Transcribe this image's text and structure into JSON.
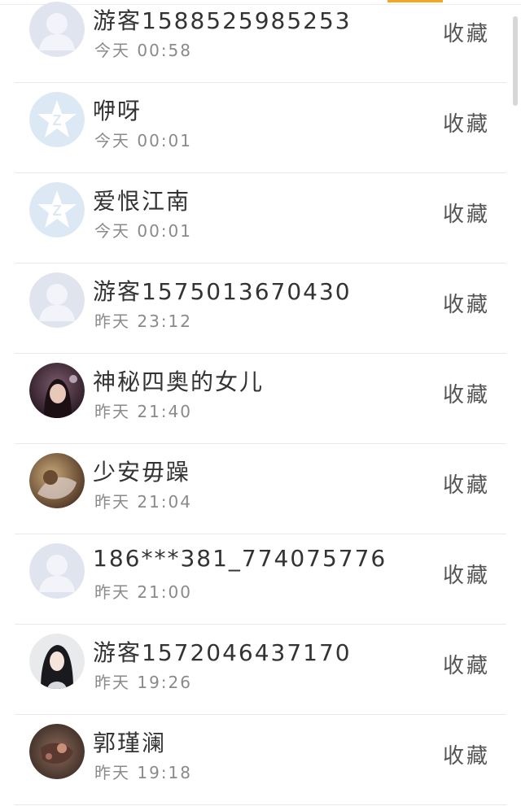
{
  "items": [
    {
      "name": "游客1588525985253",
      "time": "今天 00:58",
      "action": "收藏",
      "avatar": "default-person-icon"
    },
    {
      "name": "咿呀",
      "time": "今天 00:01",
      "action": "收藏",
      "avatar": "qq-star-icon"
    },
    {
      "name": "爱恨江南",
      "time": "今天 00:01",
      "action": "收藏",
      "avatar": "qq-star-icon"
    },
    {
      "name": "游客1575013670430",
      "time": "昨天 23:12",
      "action": "收藏",
      "avatar": "default-person-icon"
    },
    {
      "name": "神秘四奥的女儿",
      "time": "昨天 21:40",
      "action": "收藏",
      "avatar": "photo-avatar"
    },
    {
      "name": "少安毋躁",
      "time": "昨天 21:04",
      "action": "收藏",
      "avatar": "photo-avatar"
    },
    {
      "name": "186***381_774075776",
      "time": "昨天 21:00",
      "action": "收藏",
      "avatar": "default-person-icon"
    },
    {
      "name": "游客1572046437170",
      "time": "昨天 19:26",
      "action": "收藏",
      "avatar": "photo-avatar"
    },
    {
      "name": "郭瑾澜",
      "time": "昨天 19:18",
      "action": "收藏",
      "avatar": "photo-avatar"
    }
  ],
  "colors": {
    "accent": "#f5a623",
    "default_avatar": "#dfe4ef",
    "qq_avatar": "#dde8f5"
  }
}
